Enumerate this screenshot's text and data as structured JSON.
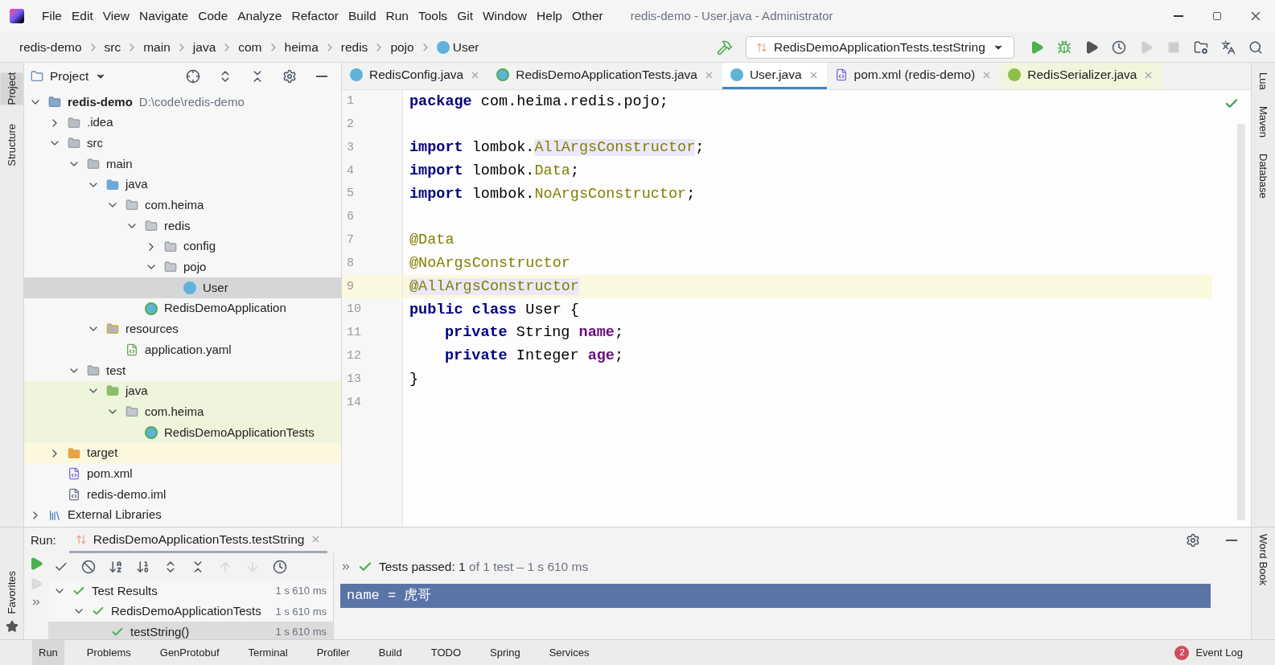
{
  "menu": [
    "File",
    "Edit",
    "View",
    "Navigate",
    "Code",
    "Analyze",
    "Refactor",
    "Build",
    "Run",
    "Tools",
    "Git",
    "Window",
    "Help",
    "Other"
  ],
  "window": {
    "title": "redis-demo - User.java - Administrator"
  },
  "breadcrumb": [
    {
      "label": "redis-demo",
      "kind": "module"
    },
    {
      "label": "src",
      "kind": "folder"
    },
    {
      "label": "main",
      "kind": "folder"
    },
    {
      "label": "java",
      "kind": "folder"
    },
    {
      "label": "com",
      "kind": "folder"
    },
    {
      "label": "heima",
      "kind": "folder"
    },
    {
      "label": "redis",
      "kind": "folder"
    },
    {
      "label": "pojo",
      "kind": "folder"
    },
    {
      "label": "User",
      "kind": "class"
    }
  ],
  "run_config": {
    "label": "RedisDemoApplicationTests.testString"
  },
  "left_strip": [
    "Project",
    "Structure"
  ],
  "project_panel": {
    "title": "Project",
    "tree": [
      {
        "label": "redis-demo",
        "path": "D:\\code\\redis-demo",
        "kind": "module",
        "expanded": true,
        "selected": false,
        "children": [
          {
            "label": ".idea",
            "kind": "folder",
            "expanded": false,
            "selected": false
          },
          {
            "label": "src",
            "kind": "folder",
            "expanded": true,
            "selected": false,
            "children": [
              {
                "label": "main",
                "kind": "folder",
                "expanded": true,
                "selected": false,
                "children": [
                  {
                    "label": "java",
                    "kind": "source-folder",
                    "expanded": true,
                    "selected": false,
                    "children": [
                      {
                        "label": "com.heima",
                        "kind": "package",
                        "expanded": true,
                        "selected": false,
                        "children": [
                          {
                            "label": "redis",
                            "kind": "package",
                            "expanded": true,
                            "selected": false,
                            "children": [
                              {
                                "label": "config",
                                "kind": "package",
                                "expanded": false,
                                "selected": false
                              },
                              {
                                "label": "pojo",
                                "kind": "package",
                                "expanded": true,
                                "selected": false,
                                "children": [
                                  {
                                    "label": "User",
                                    "kind": "class",
                                    "selected": true
                                  }
                                ]
                              }
                            ]
                          },
                          {
                            "label": "RedisDemoApplication",
                            "kind": "app-class",
                            "selected": false
                          }
                        ]
                      }
                    ]
                  },
                  {
                    "label": "resources",
                    "kind": "resource-folder",
                    "expanded": true,
                    "selected": false,
                    "children": [
                      {
                        "label": "application.yaml",
                        "kind": "yaml",
                        "selected": false
                      }
                    ]
                  }
                ]
              },
              {
                "label": "test",
                "kind": "folder",
                "expanded": true,
                "selected": false,
                "children": [
                  {
                    "label": "java",
                    "kind": "test-folder",
                    "color": "#eef5dc",
                    "expanded": true,
                    "selected": false,
                    "children": [
                      {
                        "label": "com.heima",
                        "kind": "package",
                        "color": "#eef5dc",
                        "expanded": true,
                        "selected": false,
                        "children": [
                          {
                            "label": "RedisDemoApplicationTests",
                            "kind": "app-class",
                            "color": "#eef5dc",
                            "selected": false
                          }
                        ]
                      }
                    ]
                  }
                ]
              }
            ]
          },
          {
            "label": "target",
            "kind": "excluded-folder",
            "color": "#fbf8dd",
            "expanded": false,
            "selected": false
          },
          {
            "label": "pom.xml",
            "kind": "maven",
            "selected": false
          },
          {
            "label": "redis-demo.iml",
            "kind": "module-file",
            "selected": false
          }
        ]
      },
      {
        "label": "External Libraries",
        "kind": "libraries",
        "expanded": false,
        "selected": false
      }
    ]
  },
  "editor_tabs": [
    {
      "label": "RedisConfig.java",
      "kind": "class",
      "selected": false
    },
    {
      "label": "RedisDemoApplicationTests.java",
      "kind": "app-class",
      "selected": false
    },
    {
      "label": "User.java",
      "kind": "class",
      "selected": true
    },
    {
      "label": "pom.xml (redis-demo)",
      "kind": "maven",
      "selected": false
    },
    {
      "label": "RedisSerializer.java",
      "kind": "interface",
      "selected": false
    }
  ],
  "code": [
    {
      "number": "1",
      "current": false,
      "tokens": [
        {
          "kind": "keyword",
          "text": "package"
        },
        {
          "kind": "plain",
          "text": " com.heima.redis.pojo;"
        }
      ]
    },
    {
      "number": "2",
      "current": false
    },
    {
      "number": "3",
      "current": false,
      "tokens": [
        {
          "kind": "keyword",
          "text": "import"
        },
        {
          "kind": "plain",
          "text": " lombok."
        },
        {
          "kind": "unused",
          "text": "AllArgsConstructor"
        },
        {
          "kind": "plain",
          "text": ";"
        }
      ]
    },
    {
      "number": "4",
      "current": false,
      "tokens": [
        {
          "kind": "keyword",
          "text": "import"
        },
        {
          "kind": "plain",
          "text": " lombok."
        },
        {
          "kind": "annotation",
          "text": "Data"
        },
        {
          "kind": "plain",
          "text": ";"
        }
      ]
    },
    {
      "number": "5",
      "current": false,
      "tokens": [
        {
          "kind": "keyword",
          "text": "import"
        },
        {
          "kind": "plain",
          "text": " lombok."
        },
        {
          "kind": "annotation",
          "text": "NoArgsConstructor"
        },
        {
          "kind": "plain",
          "text": ";"
        }
      ]
    },
    {
      "number": "6",
      "current": false
    },
    {
      "number": "7",
      "current": false,
      "tokens": [
        {
          "kind": "annotation",
          "text": "@Data"
        }
      ]
    },
    {
      "number": "8",
      "current": false,
      "tokens": [
        {
          "kind": "annotation",
          "text": "@NoArgsConstructor"
        }
      ]
    },
    {
      "number": "9",
      "current": true,
      "tokens": [
        {
          "kind": "unused",
          "text": "@AllArgsConstructor"
        }
      ]
    },
    {
      "number": "10",
      "current": false,
      "tokens": [
        {
          "kind": "keyword",
          "text": "public class"
        },
        {
          "kind": "plain",
          "text": " User {"
        }
      ]
    },
    {
      "number": "11",
      "current": false,
      "indented": true,
      "tokens": [
        {
          "kind": "keyword",
          "text": "private"
        },
        {
          "kind": "plain",
          "text": " String "
        },
        {
          "kind": "field",
          "text": "name"
        },
        {
          "kind": "plain",
          "text": ";"
        }
      ]
    },
    {
      "number": "12",
      "current": false,
      "indented": true,
      "tokens": [
        {
          "kind": "keyword",
          "text": "private"
        },
        {
          "kind": "plain",
          "text": " Integer "
        },
        {
          "kind": "field",
          "text": "age"
        },
        {
          "kind": "plain",
          "text": ";"
        }
      ]
    },
    {
      "number": "13",
      "current": false,
      "tokens": [
        {
          "kind": "plain",
          "text": "}"
        }
      ]
    },
    {
      "number": "14",
      "current": false
    }
  ],
  "right_strip": [
    "Lua",
    "Maven",
    "Database",
    "Word Book"
  ],
  "run_panel": {
    "label": "Run:",
    "tab": "RedisDemoApplicationTests.testString",
    "status": {
      "bold": "Tests passed: 1",
      "rest": "of 1 test – 1 s 610 ms"
    },
    "results": [
      {
        "label": "Test Results",
        "time": "1 s 610 ms",
        "expanded": true,
        "selected": false,
        "children": [
          {
            "label": "RedisDemoApplicationTests",
            "time": "1 s 610 ms",
            "expanded": true,
            "selected": false,
            "children": [
              {
                "label": "testString()",
                "time": "1 s 610 ms",
                "selected": true
              }
            ]
          }
        ]
      }
    ],
    "console": [
      {
        "text": "name = 虎哥",
        "selected": true
      }
    ]
  },
  "bottom_tabs": [
    "Run",
    "Problems",
    "GenProtobuf",
    "Terminal",
    "Profiler",
    "Build",
    "TODO",
    "Spring",
    "Services"
  ],
  "event_log": {
    "label": "Event Log",
    "count": "2"
  },
  "favorites": "Favorites"
}
